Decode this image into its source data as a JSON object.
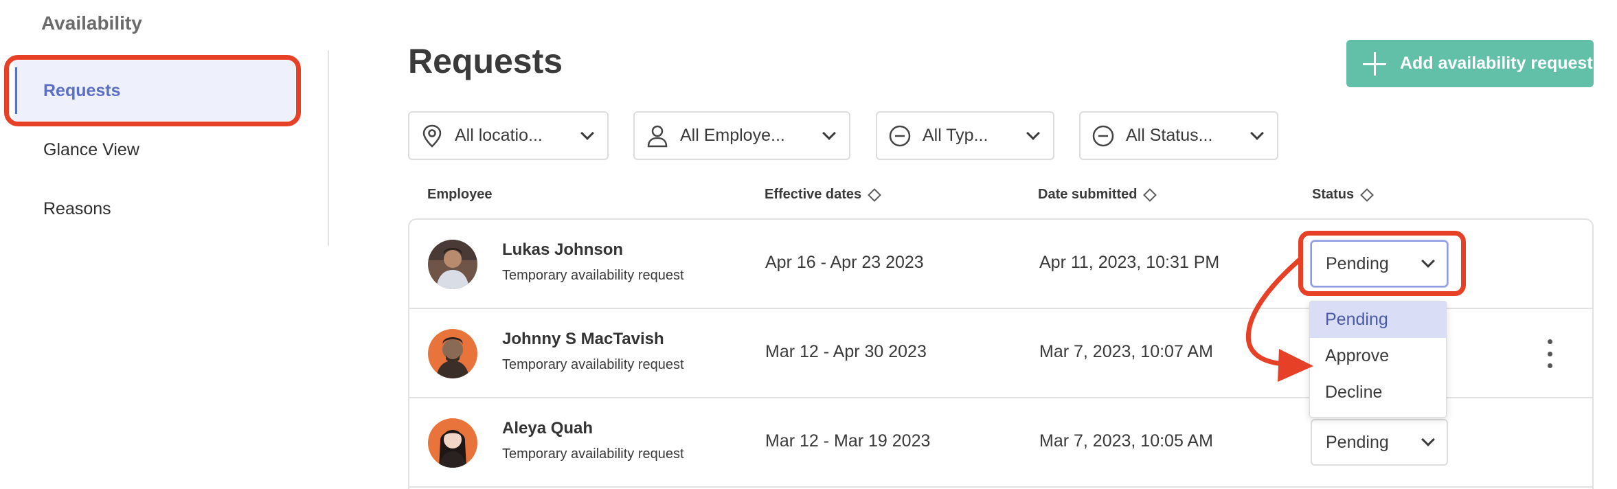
{
  "sidebar": {
    "title": "Availability",
    "items": [
      {
        "label": "Requests",
        "active": true
      },
      {
        "label": "Glance View",
        "active": false
      },
      {
        "label": "Reasons",
        "active": false
      }
    ]
  },
  "header": {
    "title": "Requests",
    "add_button_label": "Add availability request"
  },
  "filters": [
    {
      "icon": "location-pin-icon",
      "label": "All locatio..."
    },
    {
      "icon": "person-icon",
      "label": "All Employe..."
    },
    {
      "icon": "minus-circle-icon",
      "label": "All Typ..."
    },
    {
      "icon": "minus-circle-icon",
      "label": "All Status..."
    }
  ],
  "table": {
    "columns": [
      "Employee",
      "Effective dates",
      "Date submitted",
      "Status"
    ],
    "rows": [
      {
        "name": "Lukas Johnson",
        "type": "Temporary availability request",
        "dates": "Apr 16 - Apr 23 2023",
        "submitted": "Apr 11, 2023, 10:31 PM",
        "status": "Pending"
      },
      {
        "name": "Johnny S MacTavish",
        "type": "Temporary availability request",
        "dates": "Mar 12 - Apr 30 2023",
        "submitted": "Mar 7, 2023, 10:07 AM",
        "status": "Pending"
      },
      {
        "name": "Aleya Quah",
        "type": "Temporary availability request",
        "dates": "Mar 12 - Mar 19 2023",
        "submitted": "Mar 7, 2023, 10:05 AM",
        "status": "Pending"
      }
    ]
  },
  "status_menu": {
    "options": [
      "Pending",
      "Approve",
      "Decline"
    ],
    "selected": "Pending"
  },
  "colors": {
    "accent": "#5b6fc5",
    "add_button": "#62c0a8",
    "annotation": "#e64027",
    "active_bg": "#eef0fb"
  }
}
